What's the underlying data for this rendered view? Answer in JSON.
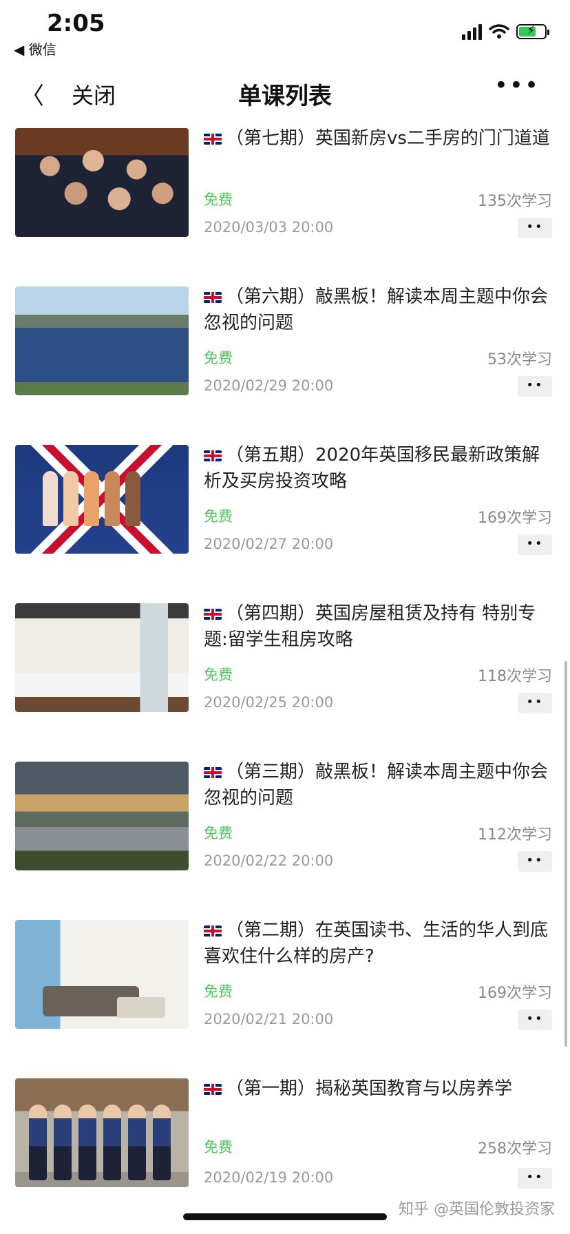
{
  "status_bar": {
    "time": "2:05",
    "back_app": "◀ 微信"
  },
  "nav": {
    "back_icon": "chevron-left-icon",
    "close_label": "关闭",
    "title": "单课列表",
    "more_label": "•••"
  },
  "lessons": [
    {
      "title": "（第七期）英国新房vs二手房的门门道道",
      "price": "免费",
      "views": "135次学习",
      "date": "2020/03/03 20:00",
      "thumb": "classroom-students"
    },
    {
      "title": "（第六期）敲黑板！解读本周主题中你会忽视的问题",
      "price": "免费",
      "views": "53次学习",
      "date": "2020/02/29 20:00",
      "thumb": "london-reservoir"
    },
    {
      "title": "（第五期）2020年英国移民最新政策解析及买房投资攻略",
      "price": "免费",
      "views": "169次学习",
      "date": "2020/02/27 20:00",
      "thumb": "union-jack-paper-people"
    },
    {
      "title": "（第四期）英国房屋租赁及持有 特别专题:留学生租房攻略",
      "price": "免费",
      "views": "118次学习",
      "date": "2020/02/25 20:00",
      "thumb": "student-bedroom"
    },
    {
      "title": "（第三期）敲黑板！解读本周主题中你会忽视的问题",
      "price": "免费",
      "views": "112次学习",
      "date": "2020/02/22 20:00",
      "thumb": "london-sunset-lake"
    },
    {
      "title": "（第二期）在英国读书、生活的华人到底喜欢住什么样的房产?",
      "price": "免费",
      "views": "169次学习",
      "date": "2020/02/21 20:00",
      "thumb": "apartment-living-room"
    },
    {
      "title": "（第一期）揭秘英国教育与以房养学",
      "price": "免费",
      "views": "258次学习",
      "date": "2020/02/19 20:00",
      "thumb": "school-children"
    }
  ],
  "more_button_label": "••",
  "watermark": "知乎 @英国伦敦投资家",
  "colors": {
    "free_green": "#4cc75a",
    "muted_gray": "#999999",
    "battery_green": "#34c759"
  }
}
